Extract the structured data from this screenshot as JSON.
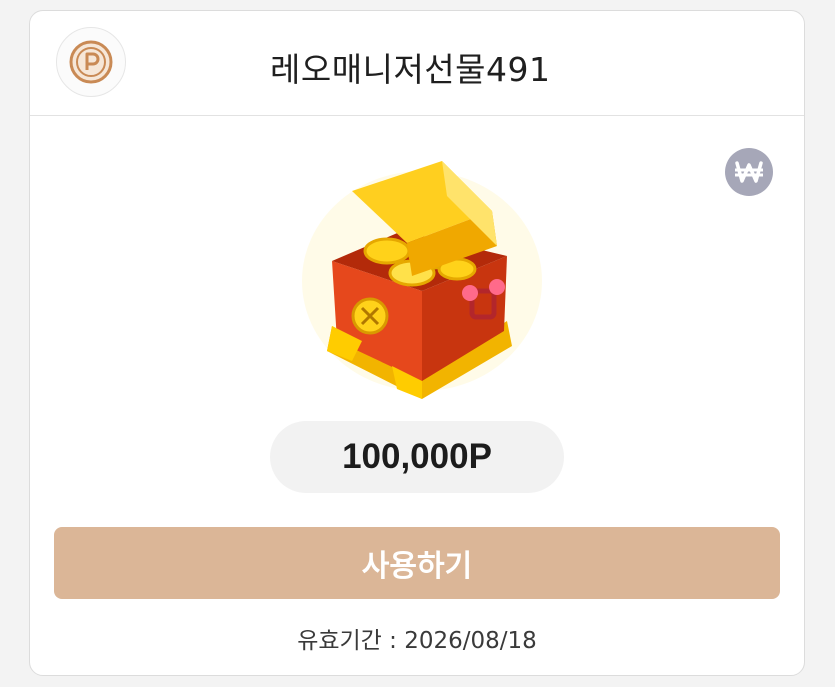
{
  "header": {
    "logo_icon": "point-p-icon",
    "title": "레오매니저선물491"
  },
  "reward": {
    "image_icon": "treasure-chest-icon",
    "currency_badge_icon": "won-icon",
    "amount": "100,000P"
  },
  "actions": {
    "use_label": "사용하기"
  },
  "validity": {
    "label": "유효기간",
    "separator": " : ",
    "date": "2026/08/18"
  },
  "colors": {
    "button": "#dbb697",
    "logo_ring": "#c98a55",
    "badge": "#a6a7b8",
    "chest_red": "#e6481c",
    "gold": "#ffd21a"
  }
}
